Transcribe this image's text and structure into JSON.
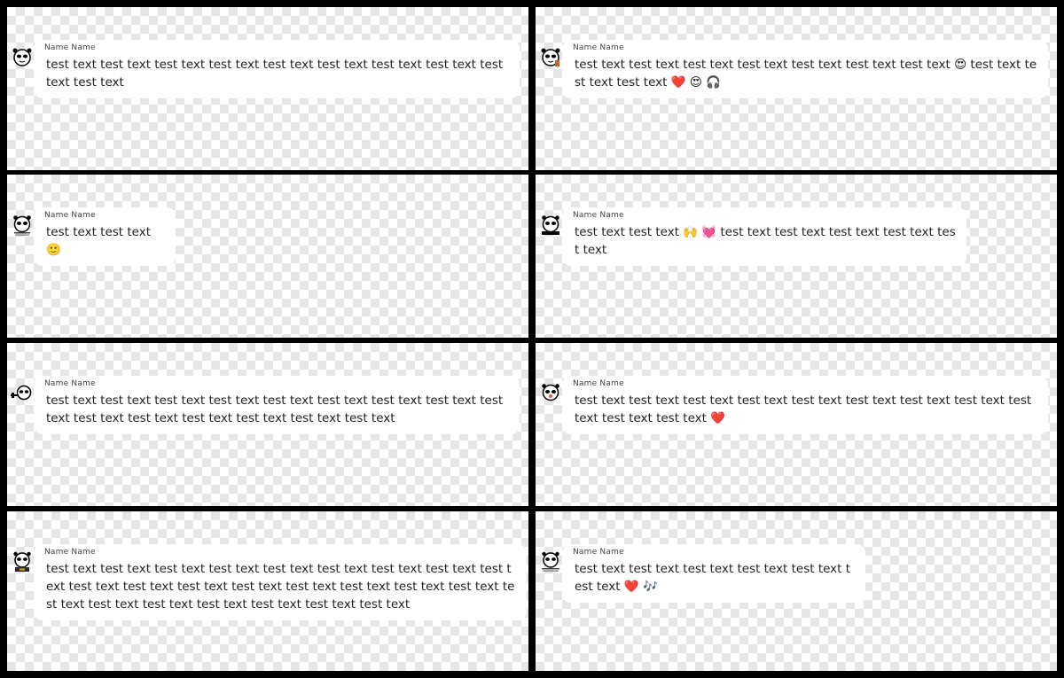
{
  "messages": [
    {
      "name": "Name Name",
      "text": " test text test text test text test text test text test text test text test text test text test text"
    },
    {
      "name": "Name Name",
      "text": " test text test text test text test text test text test text test text 😍  test text test text test text ❤️ 😍 🎧"
    },
    {
      "name": "Name Name",
      "text": " test text test text 🙂"
    },
    {
      "name": "Name Name",
      "text": " test text test text 🙌 💓  test text test text test text test text test text"
    },
    {
      "name": "Name Name",
      "text": " test text test text test text test text test text test text test text test text test text test text  test text test text test text test text test text"
    },
    {
      "name": "Name Name",
      "text": " test text test text test text test text test text test text test text test text test text test text test text ❤️"
    },
    {
      "name": "Name Name",
      "text": " test text test text test text test text test text test text test text test text test text test text test text test text test text test text test text test text test text test text test text test text test text test text test text test text"
    },
    {
      "name": "Name Name",
      "text": " test text test text test text test text test text test text ❤️ 🎶"
    }
  ]
}
